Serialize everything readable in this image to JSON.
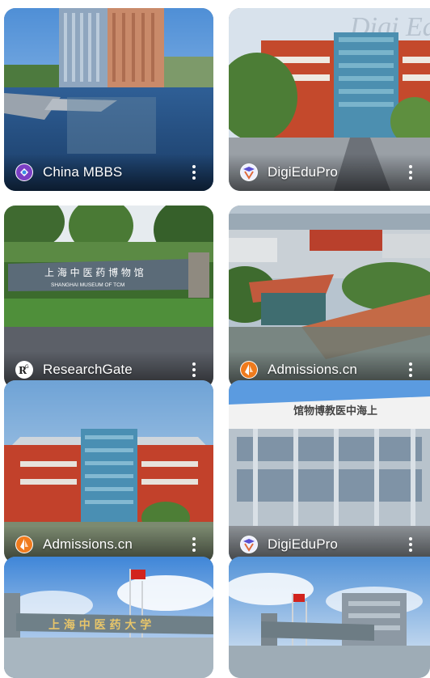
{
  "cards": [
    {
      "source": "China MBBS",
      "icon": "china-mbbs-logo-icon"
    },
    {
      "source": "DigiEduPro",
      "icon": "digiedupro-logo-icon"
    },
    {
      "source": "ResearchGate",
      "icon": "researchgate-logo-icon"
    },
    {
      "source": "Admissions.cn",
      "icon": "admissions-cn-logo-icon"
    },
    {
      "source": "Admissions.cn",
      "icon": "admissions-cn-logo-icon"
    },
    {
      "source": "DigiEduPro",
      "icon": "digiedupro-logo-icon"
    },
    {
      "source": "",
      "icon": ""
    },
    {
      "source": "",
      "icon": ""
    }
  ],
  "image_texts": {
    "museum_sign_cn": "上 海 中 医 药 博 物 馆",
    "museum_sign_en": "SHANGHAI MUSEUM OF TCM",
    "gate_sign_cn": "上 海 中 医 药 大 学",
    "building_sign_cn": "馆物博教医中海上",
    "watermark": "Digi Ed"
  },
  "colors": {
    "china_mbbs": "#7b3fc4",
    "digiedupro": "#5a4fd0",
    "researchgate": "#ffffff",
    "admissions": "#f07b1d"
  }
}
